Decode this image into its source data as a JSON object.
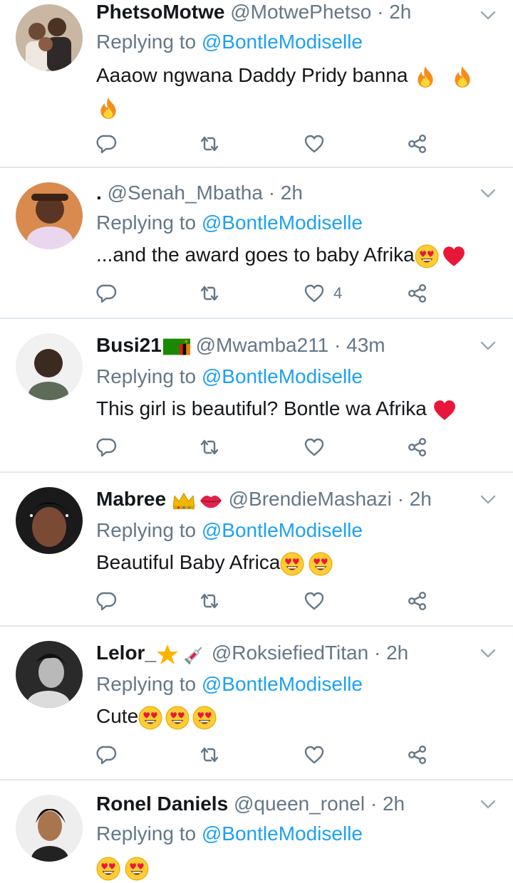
{
  "tweets": [
    {
      "name": "PhetsoMotwe",
      "handle": "@MotwePhetso",
      "time": "· 2h",
      "replying_prefix": "Replying to",
      "mention": "@BontleModiselle",
      "text": "Aaaow ngwana Daddy Pridy banna",
      "text_emoji": [
        "fire",
        "fire",
        "fire"
      ],
      "name_emoji": [],
      "like_count": ""
    },
    {
      "name": ".",
      "handle": "@Senah_Mbatha",
      "time": "· 2h",
      "replying_prefix": "Replying to",
      "mention": "@BontleModiselle",
      "text": "...and the award goes to baby Afrika",
      "text_emoji": [
        "heart-eyes",
        "red-heart"
      ],
      "name_emoji": [],
      "like_count": "4"
    },
    {
      "name": "Busi21",
      "handle": "@Mwamba211",
      "time": "· 43m",
      "replying_prefix": "Replying to",
      "mention": "@BontleModiselle",
      "text": "This girl is beautiful? Bontle wa Afrika",
      "text_emoji": [
        "red-heart"
      ],
      "name_emoji": [
        "zambia-flag"
      ],
      "like_count": ""
    },
    {
      "name": "Mabree",
      "handle": "@BrendieMashazi",
      "time": "· 2h",
      "replying_prefix": "Replying to",
      "mention": "@BontleModiselle",
      "text": "Beautiful Baby Africa",
      "text_emoji": [
        "heart-eyes",
        "heart-eyes"
      ],
      "name_emoji": [
        "crown",
        "kiss-lips"
      ],
      "like_count": ""
    },
    {
      "name": "Lelor_",
      "handle": "@RoksiefiedTitan",
      "time": "· 2h",
      "replying_prefix": "Replying to",
      "mention": "@BontleModiselle",
      "text": "Cute",
      "text_emoji": [
        "heart-eyes",
        "heart-eyes",
        "heart-eyes"
      ],
      "name_emoji": [
        "star",
        "syringe"
      ],
      "like_count": ""
    },
    {
      "name": "Ronel Daniels",
      "handle": "@queen_ronel",
      "time": "· 2h",
      "replying_prefix": "Replying to",
      "mention": "@BontleModiselle",
      "text": "",
      "text_emoji": [
        "heart-eyes",
        "heart-eyes"
      ],
      "name_emoji": [],
      "like_count": ""
    }
  ],
  "icons": {
    "reply": "reply-icon",
    "retweet": "retweet-icon",
    "like": "like-icon",
    "share": "share-icon",
    "menu": "chevron-down-icon"
  },
  "colors": {
    "text": "#14171a",
    "secondary": "#657786",
    "link": "#1da1f2",
    "divider": "#e1e8ed"
  }
}
